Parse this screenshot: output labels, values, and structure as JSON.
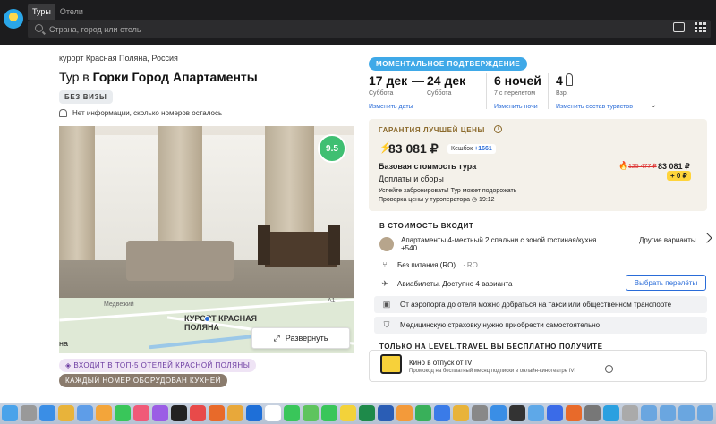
{
  "browser": {
    "tabs": [
      "Туры",
      "Отели"
    ],
    "search_placeholder": "Страна, город или отель"
  },
  "hotel": {
    "location": "курорт Красная Поляна, Россия",
    "title_prefix": "Тур в ",
    "title_name": "Горки Город Апартаменты",
    "visa_badge": "БЕЗ ВИЗЫ",
    "rooms_note": "Нет информации, сколько номеров осталось",
    "rating": "9.5",
    "map_label": "КУРОРТ КРАСНАЯ ПОЛЯНА",
    "map_small_1": "Медвежий",
    "map_small_2": "А1",
    "map_small_3": "на",
    "expand_button": "Развернуть",
    "promo_top5": "ВХОДИТ В ТОП-5 ОТЕЛЕЙ КРАСНОЙ ПОЛЯНЫ",
    "promo_kitchen": "КАЖДЫЙ НОМЕР ОБОРУДОВАН КУХНЕЙ"
  },
  "booking": {
    "confirm_badge": "МОМЕНТАЛЬНОЕ ПОДТВЕРЖДЕНИЕ",
    "date_from": "17 дек",
    "date_from_day": "Суббота",
    "date_to": "24 дек",
    "date_to_day": "Суббота",
    "dash": "—",
    "nights": "6 ночей",
    "nights_sub": "7 с перелетом",
    "guests": "4",
    "guests_sub": "Взр.",
    "change_dates": "Изменить даты",
    "change_nights": "Изменить ночи",
    "change_tourists": "Изменить состав туристов",
    "chevron": "⌄"
  },
  "price": {
    "guarantee": "ГАРАНТИЯ ЛУЧШЕЙ ЦЕНЫ",
    "main_price": "83 081 ₽",
    "cashback_label": "Кешбэк",
    "cashback_value": "+1661",
    "base_label": "Базовая стоимость тура",
    "fees_label": "Доплаты и сборы",
    "old_price": "125 477 ₽",
    "new_price": "83 081 ₽",
    "fee_value": "+ 0 ₽",
    "hurry": "Успейте забронировать! Тур может подорожать",
    "check": "Проверка цены у туроператора",
    "check_time": "19:12"
  },
  "included": {
    "title": "В СТОИМОСТЬ ВХОДИТ",
    "room": "Апартаменты 4-местный 2 спальни с зоной гостиная/кухня",
    "room_extra": "+540",
    "other_variants": "Другие варианты",
    "meal": "Без питания (RO)",
    "meal_code": "· RO",
    "flights": "Авиабилеты. Доступно 4 варианта",
    "choose_flights": "Выбрать перелёты",
    "transfer_note": "От аэропорта до отеля можно добраться на такси или общественном транспорте",
    "insurance_note": "Медицинскую страховку нужно приобрести самостоятельно"
  },
  "free": {
    "title": "ТОЛЬКО НА LEVEL.TRAVEL ВЫ БЕСПЛАТНО ПОЛУЧИТЕ",
    "main": "Кино в отпуск от IVI",
    "sub": "Промокод на бесплатный месяц подписки в онлайн-кинотеатре IVI"
  },
  "dock": {
    "icons": [
      "finder-icon",
      "launchpad-icon",
      "safari-icon",
      "chrome-icon",
      "mail-icon",
      "photos-icon",
      "whatsapp-icon",
      "music-icon",
      "podcasts-icon",
      "tv-icon",
      "news-icon",
      "firefox-icon",
      "photos2-icon",
      "outlook-icon",
      "calendar-icon",
      "facetime-icon",
      "maps-icon",
      "messages-icon",
      "notes-icon",
      "excel-icon",
      "word-icon",
      "pages-icon",
      "numbers-icon",
      "keynote-icon",
      "chrome2-icon",
      "system-prefs-icon",
      "appstore-icon",
      "terminal-icon",
      "preview-icon",
      "xcode-icon",
      "firefox2-icon",
      "settings-icon",
      "telegram-icon",
      "files-icon",
      "folder-icon",
      "folder2-icon",
      "folder3-icon",
      "folder4-icon",
      "folder5-icon",
      "trash-icon"
    ],
    "colors": [
      "#4aa3ea",
      "#999",
      "#3a8ee6",
      "#e8b33a",
      "#5e9de8",
      "#f3a53a",
      "#39c65a",
      "#f05a78",
      "#9b5de5",
      "#222",
      "#e84a4a",
      "#e86a2a",
      "#e8a83a",
      "#1e6fd8",
      "#fff",
      "#39c65a",
      "#5ec45e",
      "#39c65a",
      "#f3d23a",
      "#1e8a4a",
      "#2a5db5",
      "#f39a3a",
      "#39b05a",
      "#3a7be8",
      "#e8b33a",
      "#888",
      "#3a8ee6",
      "#333",
      "#5ea8e8",
      "#3a6be8",
      "#e86a2a",
      "#777",
      "#2aa0e0",
      "#aaa",
      "#6aa6e0",
      "#6aa6e0",
      "#6aa6e0",
      "#6aa6e0",
      "#6aa6e0",
      "#999"
    ]
  }
}
